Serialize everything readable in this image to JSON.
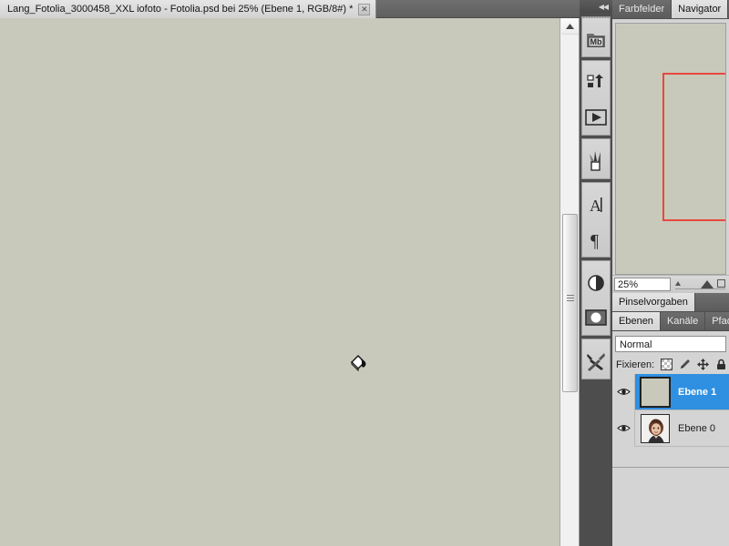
{
  "document_tab": {
    "title": "Lang_Fotolia_3000458_XXL iofoto - Fotolia.psd bei 25% (Ebene 1, RGB/8#) *",
    "close_label": "✕",
    "close_icon_name": "close-icon"
  },
  "canvas": {
    "fill_color": "#c8c9ba",
    "cursor_tool": "paint-bucket-cursor"
  },
  "scrollbar": {
    "up_arrow": "▲"
  },
  "dock": {
    "collapse_label": "◀◀",
    "groups": [
      {
        "items": [
          {
            "icon": "mini-bridge-icon",
            "label": "Mb"
          }
        ]
      },
      {
        "items": [
          {
            "icon": "history-icon",
            "label": ""
          },
          {
            "icon": "actions-play-icon",
            "label": ""
          }
        ]
      },
      {
        "items": [
          {
            "icon": "brush-presets-icon",
            "label": ""
          }
        ]
      },
      {
        "items": [
          {
            "icon": "character-icon",
            "label": "A"
          },
          {
            "icon": "paragraph-icon",
            "label": "¶"
          }
        ]
      },
      {
        "items": [
          {
            "icon": "adjustments-icon",
            "label": ""
          },
          {
            "icon": "masks-icon",
            "label": ""
          }
        ]
      },
      {
        "items": [
          {
            "icon": "tool-presets-icon",
            "label": ""
          }
        ]
      }
    ]
  },
  "navigator": {
    "tabs": [
      {
        "label": "Farbfelder",
        "active": false
      },
      {
        "label": "Navigator",
        "active": true
      }
    ],
    "zoom_value": "25%",
    "viewbox_color": "#e8483f",
    "canvas_color": "#c8c9ba"
  },
  "brush_presets": {
    "tabs": [
      {
        "label": "Pinselvorgaben",
        "active": true
      }
    ]
  },
  "layers": {
    "tabs": [
      {
        "label": "Ebenen",
        "active": true
      },
      {
        "label": "Kanäle",
        "active": false
      },
      {
        "label": "Pfade",
        "active": false
      }
    ],
    "blend_mode": "Normal",
    "lock_label": "Fixieren:",
    "lock_icons": [
      "lock-transparency-icon",
      "lock-pixels-icon",
      "lock-position-icon",
      "lock-all-icon"
    ],
    "rows": [
      {
        "name": "Ebene 1",
        "selected": true,
        "visible": true,
        "thumb_type": "solid-fill",
        "thumb_color": "#c8c9ba",
        "eye_icon": "eye-icon"
      },
      {
        "name": "Ebene 0",
        "selected": false,
        "visible": true,
        "thumb_type": "photo-portrait",
        "thumb_color": "#ffffff",
        "eye_icon": "eye-icon"
      }
    ]
  },
  "colors": {
    "selection_blue": "#2f8fe0",
    "panel_gray": "#d4d4d4",
    "dock_dark": "#4d4d4d",
    "tabbar_dark": "#6d6d6d"
  }
}
